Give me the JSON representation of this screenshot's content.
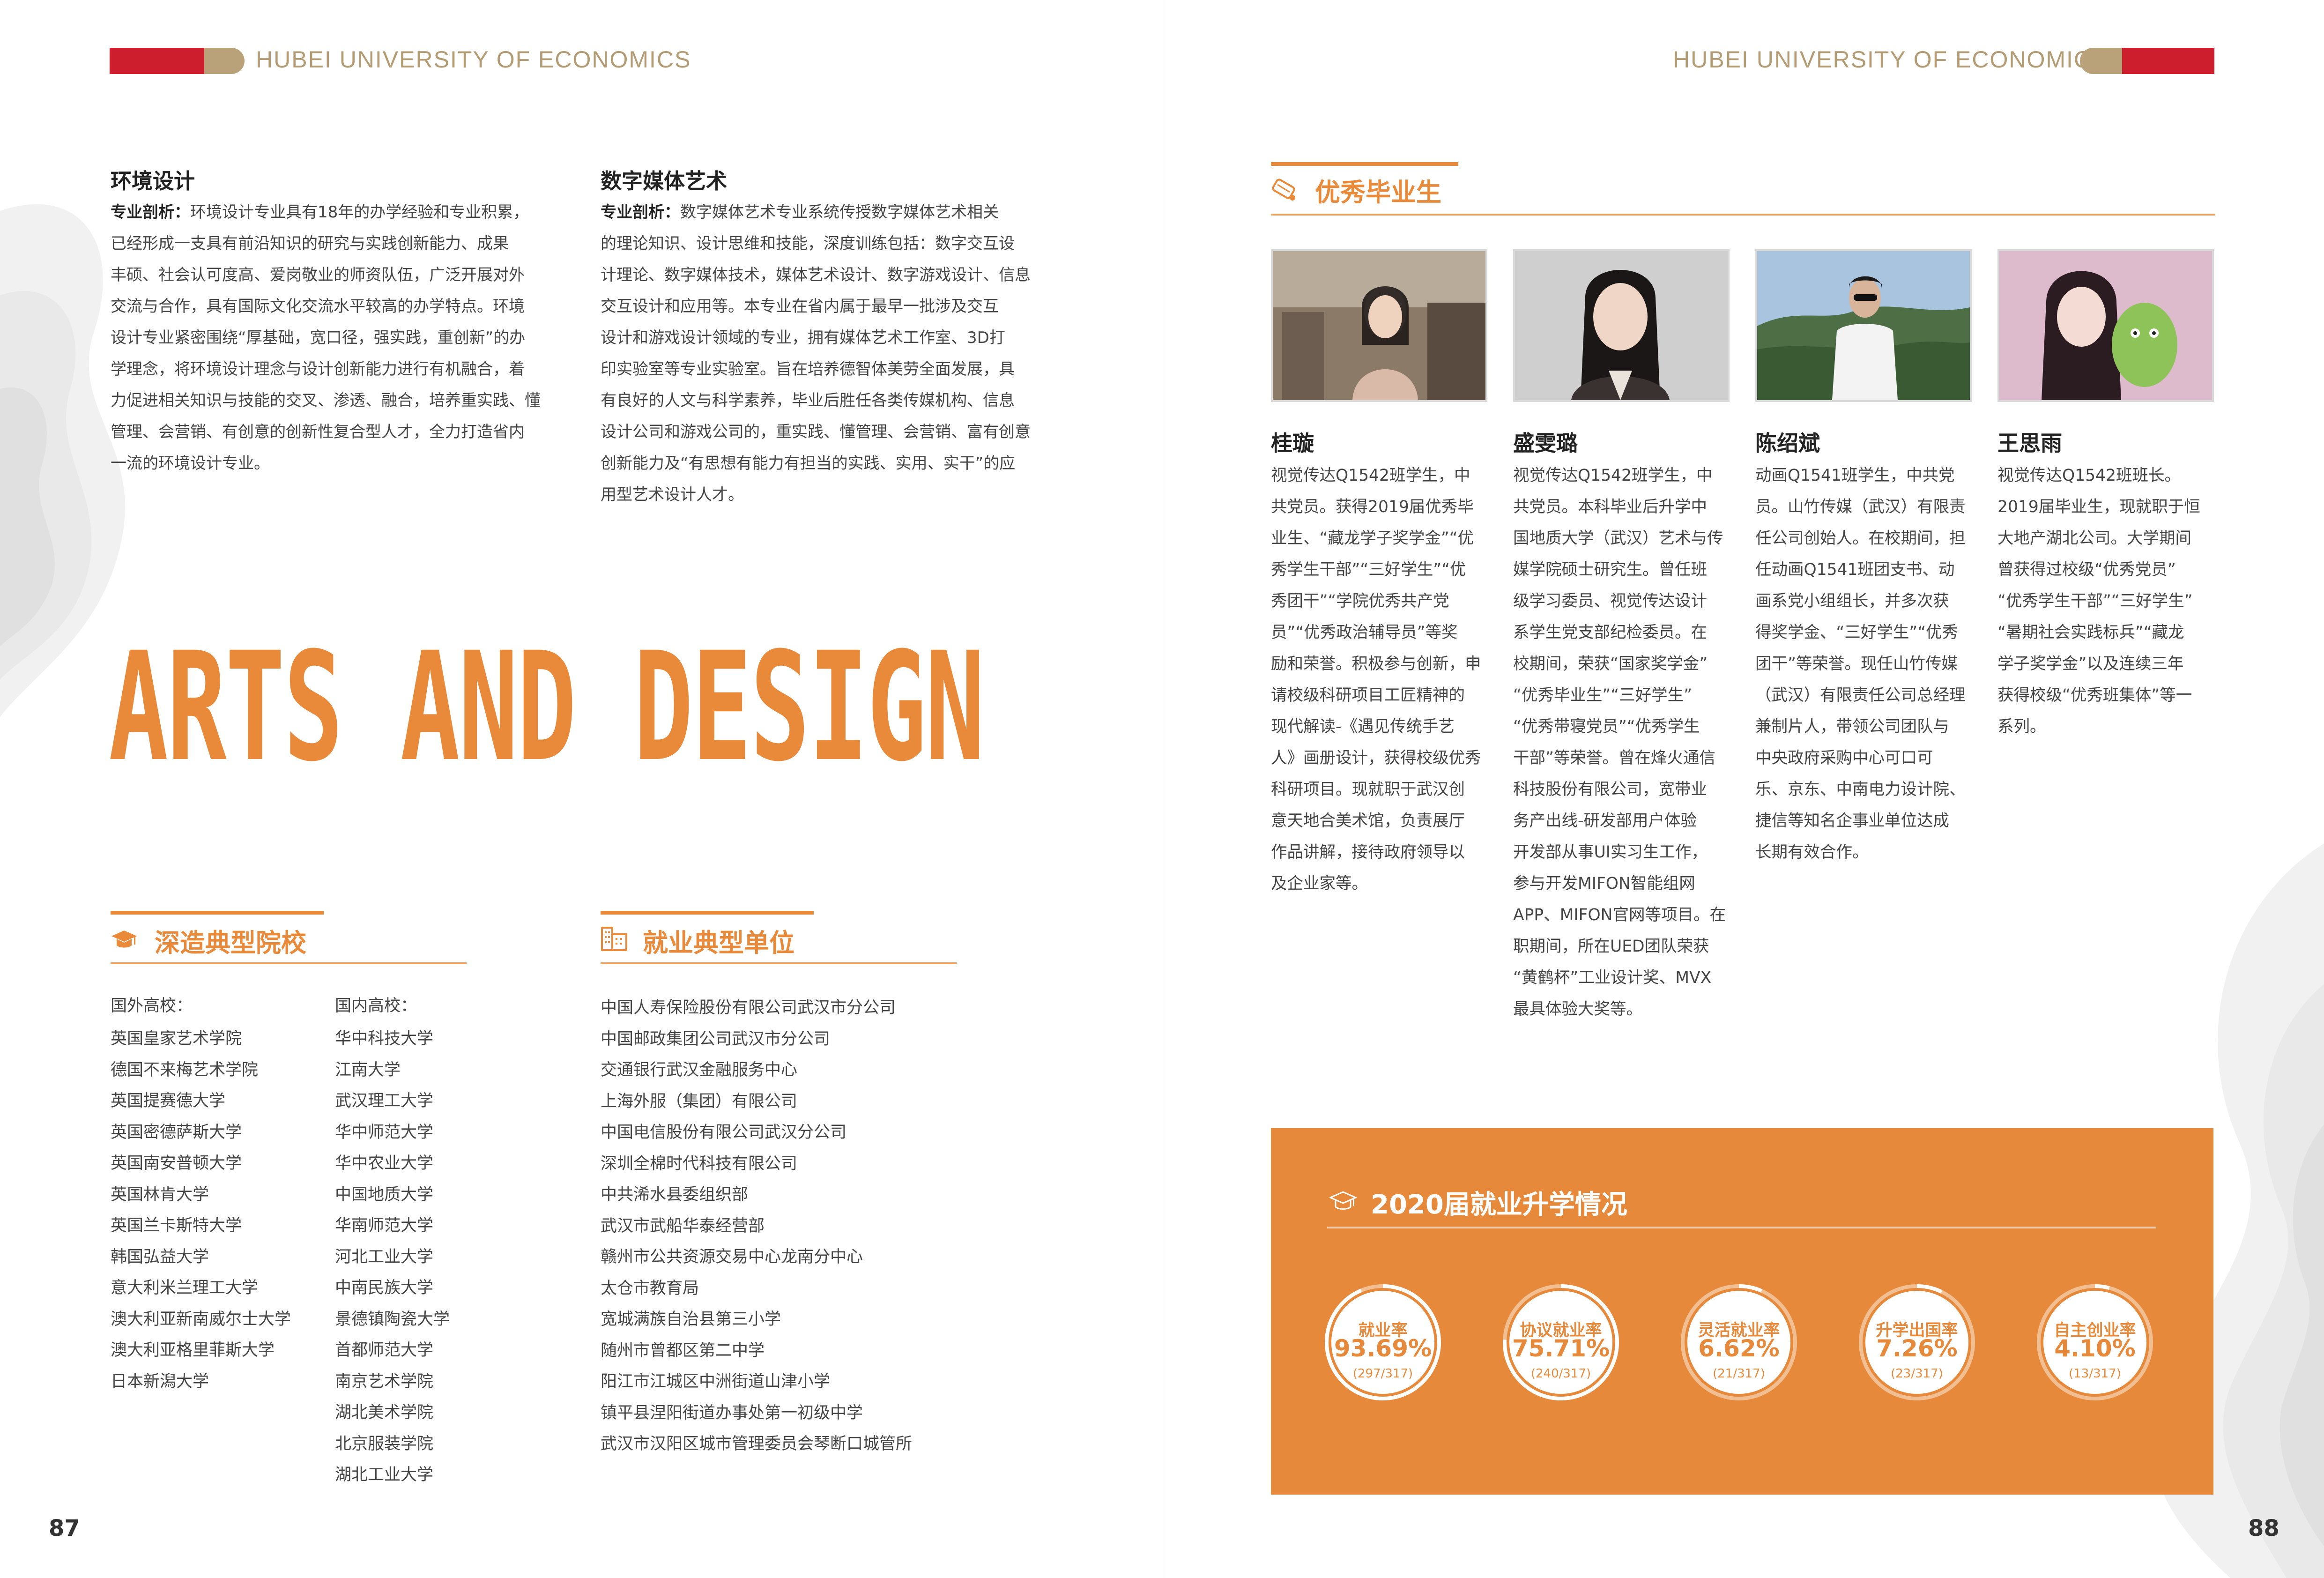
{
  "header": {
    "university": "HUBEI UNIVERSITY OF ECONOMICS"
  },
  "left": {
    "env_design": {
      "title": "环境设计",
      "label": "专业剖析：",
      "lines": [
        "环境设计专业具有18年的办学经验和专业积累，",
        "已经形成一支具有前沿知识的研究与实践创新能力、成果",
        "丰硕、社会认可度高、爱岗敬业的师资队伍，广泛开展对外",
        "交流与合作，具有国际文化交流水平较高的办学特点。环境",
        "设计专业紧密围绕“厚基础，宽口径，强实践，重创新”的办",
        "学理念，将环境设计理念与设计创新能力进行有机融合，着",
        "力促进相关知识与技能的交叉、渗透、融合，培养重实践、懂",
        "管理、会营销、有创意的创新性复合型人才，全力打造省内",
        "一流的环境设计专业。"
      ]
    },
    "digital_media": {
      "title": "数字媒体艺术",
      "label": "专业剖析：",
      "lines": [
        "数字媒体艺术专业系统传授数字媒体艺术相关",
        "的理论知识、设计思维和技能，深度训练包括：数字交互设",
        "计理论、数字媒体技术，媒体艺术设计、数字游戏设计、信息",
        "交互设计和应用等。本专业在省内属于最早一批涉及交互",
        "设计和游戏设计领域的专业，拥有媒体艺术工作室、3D打",
        "印实验室等专业实验室。旨在培养德智体美劳全面发展，具",
        "有良好的人文与科学素养，毕业后胜任各类传媒机构、信息",
        "设计公司和游戏公司的，重实践、懂管理、会营销、富有创意",
        "创新能力及“有思想有能力有担当的实践、实用、实干”的应",
        "用型艺术设计人才。"
      ]
    },
    "big_title": "ARTS AND DESIGN",
    "schools": {
      "title": "深造典型院校",
      "foreign_label": "国外高校：",
      "foreign": [
        "英国皇家艺术学院",
        "德国不来梅艺术学院",
        "英国提赛德大学",
        "英国密德萨斯大学",
        "英国南安普顿大学",
        "英国林肯大学",
        "英国兰卡斯特大学",
        "韩国弘益大学",
        "意大利米兰理工大学",
        "澳大利亚新南威尔士大学",
        "澳大利亚格里菲斯大学",
        "日本新潟大学"
      ],
      "domestic_label": "国内高校：",
      "domestic": [
        "华中科技大学",
        "江南大学",
        "武汉理工大学",
        "华中师范大学",
        "华中农业大学",
        "中国地质大学",
        "华南师范大学",
        "河北工业大学",
        "中南民族大学",
        "景德镇陶瓷大学",
        "首都师范大学",
        "南京艺术学院",
        "湖北美术学院",
        "北京服装学院",
        "湖北工业大学"
      ]
    },
    "employers": {
      "title": "就业典型单位",
      "items": [
        "中国人寿保险股份有限公司武汉市分公司",
        "中国邮政集团公司武汉市分公司",
        "交通银行武汉金融服务中心",
        "上海外服（集团）有限公司",
        "中国电信股份有限公司武汉分公司",
        "深圳全棉时代科技有限公司",
        "中共浠水县委组织部",
        "武汉市武船华泰经营部",
        "赣州市公共资源交易中心龙南分中心",
        "太仓市教育局",
        "宽城满族自治县第三小学",
        "随州市曾都区第二中学",
        "阳江市江城区中洲街道山津小学",
        "镇平县涅阳街道办事处第一初级中学",
        "武汉市汉阳区城市管理委员会琴断口城管所"
      ]
    },
    "page_number": "87"
  },
  "right": {
    "graduates_title": "优秀毕业生",
    "graduates": [
      {
        "name": "桂璇",
        "lines": [
          "视觉传达Q1542班学生，中",
          "共党员。获得2019届优秀毕",
          "业生、“藏龙学子奖学金”“优",
          "秀学生干部”“三好学生”“优",
          "秀团干”“学院优秀共产党",
          "员”“优秀政治辅导员”等奖",
          "励和荣誉。积极参与创新，申",
          "请校级科研项目工匠精神的",
          "现代解读-《遇见传统手艺",
          "人》画册设计，获得校级优秀",
          "科研项目。现就职于武汉创",
          "意天地合美术馆，负责展厅",
          "作品讲解，接待政府领导以",
          "及企业家等。"
        ]
      },
      {
        "name": "盛雯璐",
        "lines": [
          "视觉传达Q1542班学生，中",
          "共党员。本科毕业后升学中",
          "国地质大学（武汉）艺术与传",
          "媒学院硕士研究生。曾任班",
          "级学习委员、视觉传达设计",
          "系学生党支部纪检委员。在",
          "校期间，荣获“国家奖学金”",
          "“优秀毕业生”“三好学生”",
          "“优秀带寝党员”“优秀学生",
          "干部”等荣誉。曾在烽火通信",
          "科技股份有限公司，宽带业",
          "务产出线-研发部用户体验",
          "开发部从事UI实习生工作，",
          "参与开发MIFON智能组网",
          "APP、MIFON官网等项目。在",
          "职期间，所在UED团队荣获",
          "“黄鹤杯”工业设计奖、MVX",
          "最具体验大奖等。"
        ]
      },
      {
        "name": "陈绍斌",
        "lines": [
          "动画Q1541班学生，中共党",
          "员。山竹传媒（武汉）有限责",
          "任公司创始人。在校期间，担",
          "任动画Q1541班团支书、动",
          "画系党小组组长，并多次获",
          "得奖学金、“三好学生”“优秀",
          "团干”等荣誉。现任山竹传媒",
          "（武汉）有限责任公司总经理",
          "兼制片人，带领公司团队与",
          "中央政府采购中心可口可",
          "乐、京东、中南电力设计院、",
          "捷信等知名企事业单位达成",
          "长期有效合作。"
        ]
      },
      {
        "name": "王思雨",
        "lines": [
          "视觉传达Q1542班班长。",
          "2019届毕业生，现就职于恒",
          "大地产湖北公司。大学期间",
          "曾获得过校级“优秀党员”",
          "“优秀学生干部”“三好学生”",
          "“暑期社会实践标兵”“藏龙",
          "学子奖学金”以及连续三年",
          "获得校级“优秀班集体”等一",
          "系列。"
        ]
      }
    ],
    "stats": {
      "title": "2020届就业升学情况",
      "items": [
        {
          "label": "就业率",
          "value": "93.69%",
          "count": "(297/317)",
          "ratio": 0.9369
        },
        {
          "label": "协议就业率",
          "value": "75.71%",
          "count": "(240/317)",
          "ratio": 0.7571
        },
        {
          "label": "灵活就业率",
          "value": "6.62%",
          "count": "(21/317)",
          "ratio": 0.0662
        },
        {
          "label": "升学出国率",
          "value": "7.26%",
          "count": "(23/317)",
          "ratio": 0.0726
        },
        {
          "label": "自主创业率",
          "value": "4.10%",
          "count": "(13/317)",
          "ratio": 0.041
        }
      ]
    },
    "page_number": "88"
  },
  "colors": {
    "accent": "#e88a3a",
    "header_red": "#cc1e2c",
    "header_gold": "#b9a27a"
  }
}
